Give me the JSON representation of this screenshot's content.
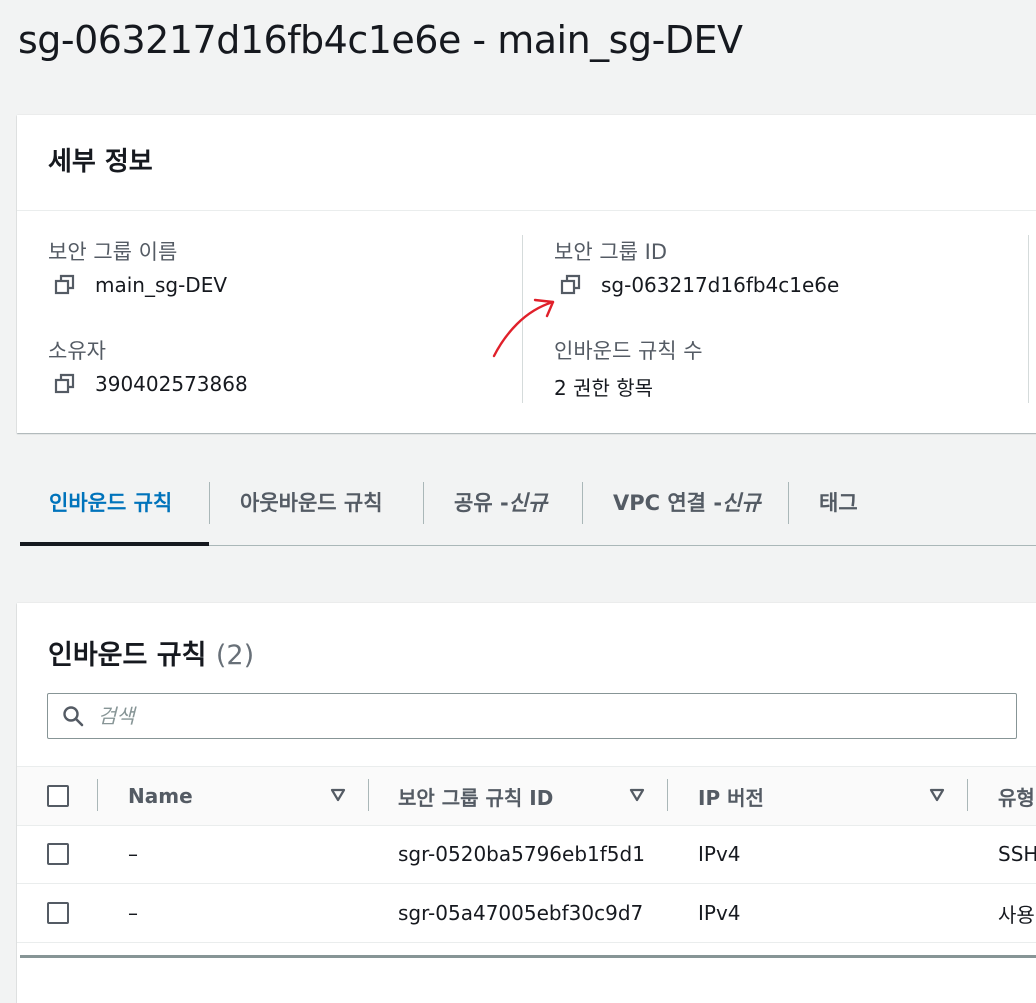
{
  "page": {
    "title": "sg-063217d16fb4c1e6e - main_sg-DEV"
  },
  "details": {
    "heading": "세부 정보",
    "sg_name_label": "보안 그룹 이름",
    "sg_name_value": "main_sg-DEV",
    "sg_id_label": "보안 그룹 ID",
    "sg_id_value": "sg-063217d16fb4c1e6e",
    "owner_label": "소유자",
    "owner_value": "390402573868",
    "inbound_count_label": "인바운드 규칙 수",
    "inbound_count_value": "2 권한 항목"
  },
  "tabs": [
    {
      "label": "인바운드 규칙",
      "active": true
    },
    {
      "label": "아웃바운드 규칙"
    },
    {
      "label": "공유 - ",
      "tag": "신규"
    },
    {
      "label": "VPC 연결 - ",
      "tag": "신규"
    },
    {
      "label": "태그"
    }
  ],
  "rules": {
    "title": "인바운드 규칙",
    "count": "(2)",
    "search_placeholder": "검색",
    "columns": [
      "Name",
      "보안 그룹 규칙 ID",
      "IP 버전",
      "유형"
    ],
    "rows": [
      {
        "name": "–",
        "rule_id": "sgr-0520ba5796eb1f5d1",
        "ip_version": "IPv4",
        "type": "SSH"
      },
      {
        "name": "–",
        "rule_id": "sgr-05a47005ebf30c9d7",
        "ip_version": "IPv4",
        "type": "사용"
      }
    ]
  },
  "colors": {
    "accent": "#0073bb",
    "annotation": "#e0202a",
    "background": "#f2f3f3"
  },
  "icons": [
    "copy-icon",
    "search-icon",
    "sort-caret-icon",
    "checkbox"
  ]
}
